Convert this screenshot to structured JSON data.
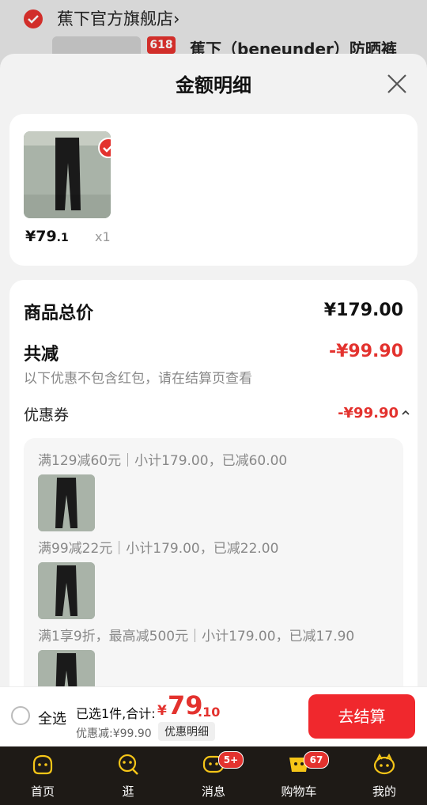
{
  "background": {
    "shop_name": "蕉下官方旗舰店",
    "shop_chevron": "›",
    "promo_tag": "618",
    "product_title": "蕉下（beneunder）防晒裤"
  },
  "sheet": {
    "title": "金额明细",
    "close_icon": "close-icon"
  },
  "product": {
    "price_main": "¥79",
    "price_decimal": ".1",
    "quantity": "x1"
  },
  "summary": {
    "total_label": "商品总价",
    "total_value": "¥179.00",
    "reduce_label": "共减",
    "reduce_value": "-¥99.90",
    "reduce_note": "以下优惠不包含红包，请在结算页查看",
    "coupon_label": "优惠券",
    "coupon_value": "-¥99.90"
  },
  "coupons": [
    {
      "rule": "满129减60元｜小计179.00，已减60.00"
    },
    {
      "rule": "满99减22元｜小计179.00，已减22.00"
    },
    {
      "rule": "满1享9折，最高减500元｜小计179.00，已减17.90"
    }
  ],
  "bottom_bar": {
    "select_all": "全选",
    "selected_text": "已选1件,合计:",
    "total_symbol": "¥",
    "total_int": "79",
    "total_dec": ".10",
    "discount_text": "优惠减:¥99.90",
    "detail_button": "优惠明细",
    "checkout_button": "去结算"
  },
  "tabbar": [
    {
      "label": "首页",
      "icon": "home-icon",
      "badge": ""
    },
    {
      "label": "逛",
      "icon": "browse-icon",
      "badge": ""
    },
    {
      "label": "消息",
      "icon": "message-icon",
      "badge": "5+"
    },
    {
      "label": "购物车",
      "icon": "cart-icon",
      "badge": "67"
    },
    {
      "label": "我的",
      "icon": "profile-icon",
      "badge": ""
    }
  ],
  "colors": {
    "accent_red": "#e3322e",
    "checkout_red": "#f0282d",
    "tabbar_bg": "#1e1a16"
  }
}
